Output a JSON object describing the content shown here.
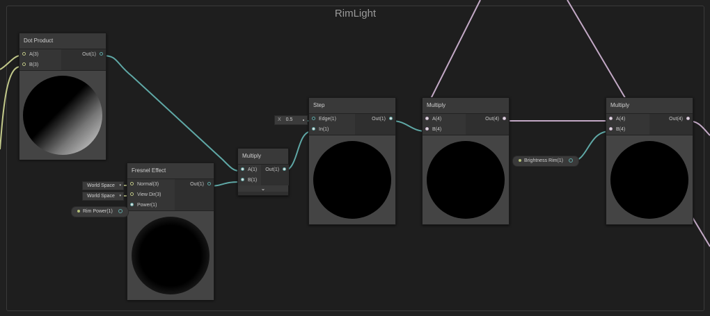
{
  "group": {
    "title": "RimLight"
  },
  "nodes": {
    "dot_product": {
      "title": "Dot Product",
      "inputs": [
        "A(3)",
        "B(3)"
      ],
      "outputs": [
        "Out(1)"
      ]
    },
    "fresnel": {
      "title": "Fresnel Effect",
      "inputs": [
        "Normal(3)",
        "View Dir(3)",
        "Power(1)"
      ],
      "outputs": [
        "Out(1)"
      ]
    },
    "multiply1": {
      "title": "Multiply",
      "inputs": [
        "A(1)",
        "B(1)"
      ],
      "outputs": [
        "Out(1)"
      ],
      "expand_icon": "chevron-down-icon"
    },
    "step": {
      "title": "Step",
      "inputs": [
        "Edge(1)",
        "In(1)"
      ],
      "outputs": [
        "Out(1)"
      ]
    },
    "multiply2": {
      "title": "Multiply",
      "inputs": [
        "A(4)",
        "B(4)"
      ],
      "outputs": [
        "Out(4)"
      ]
    },
    "multiply3": {
      "title": "Multiply",
      "inputs": [
        "A(4)",
        "B(4)"
      ],
      "outputs": [
        "Out(4)"
      ]
    }
  },
  "inline_inputs": {
    "normal_space": "World Space",
    "viewdir_space": "World Space",
    "step_edge_label": "X",
    "step_edge_value": "0.5"
  },
  "properties": {
    "rim_power": "Rim Power(1)",
    "brightness_rim": "Brightness Rim(1)"
  },
  "colors": {
    "wire_float": "#5fa8a6",
    "wire_vector3": "#c2c98a",
    "wire_vector4": "#c3a9c6"
  }
}
